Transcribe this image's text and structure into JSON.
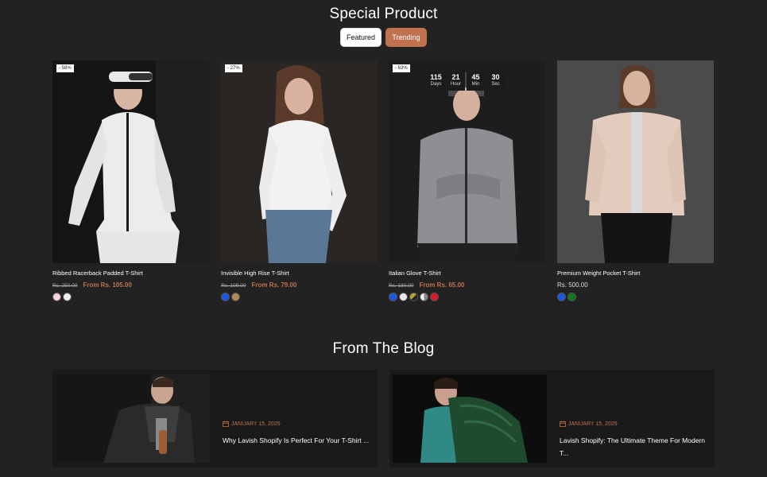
{
  "special": {
    "title": "Special Product",
    "tabs": [
      {
        "label": "Featured"
      },
      {
        "label": "Trending"
      }
    ]
  },
  "products": [
    {
      "name": "Ribbed Racerback Padded T-Shirt",
      "badge": "- 58%",
      "old_price": "Rs. 250.00",
      "price": "From Rs. 105.00",
      "swatches": [
        "#f8d3e1",
        "#eeeeee"
      ]
    },
    {
      "name": "Invisible High Rise T-Shirt",
      "badge": "- 27%",
      "old_price": "Rs. 109.00",
      "price": "From Rs. 79.00",
      "swatches": [
        "#1a56e8",
        "#b08a5e"
      ]
    },
    {
      "name": "Italian Glove T-Shirt",
      "badge": "- 63%",
      "old_price": "Rs. 180.00",
      "price": "From Rs. 65.00",
      "swatches": [
        "#1a56e8",
        "#e8e8e8",
        "#b8a12f",
        "#d9d9d9",
        "#d91a2a"
      ],
      "countdown": [
        {
          "value": "115",
          "unit": "Days"
        },
        {
          "value": "21",
          "unit": "Hour"
        },
        {
          "value": "45",
          "unit": "Min"
        },
        {
          "value": "30",
          "unit": "Sec"
        }
      ]
    },
    {
      "name": "Premium Weight Pocket T-Shirt",
      "price": "Rs. 500.00",
      "swatches": [
        "#1a56e8",
        "#0f7a1c"
      ]
    }
  ],
  "blog": {
    "title": "From The Blog",
    "posts": [
      {
        "date": "JANUARY 15, 2025",
        "title": "Why Lavish Shopify Is Perfect For Your T-Shirt ..."
      },
      {
        "date": "JANUARY 15, 2025",
        "title": "Lavish Shopify: The Ultimate Theme For Modern T..."
      }
    ]
  },
  "colors": {
    "accent": "#c0714e",
    "background": "#222222"
  }
}
